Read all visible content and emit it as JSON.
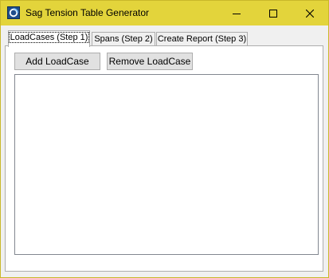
{
  "window": {
    "title": "Sag Tension Table Generator",
    "titlebar_color": "#e3d43b",
    "icons": {
      "app": "app-icon",
      "minimize": "minimize-icon",
      "maximize": "maximize-icon",
      "close": "close-icon"
    }
  },
  "tabs": [
    {
      "label": "LoadCases (Step 1)",
      "selected": true
    },
    {
      "label": "Spans (Step 2)",
      "selected": false
    },
    {
      "label": "Create Report (Step 3)",
      "selected": false
    }
  ],
  "loadcases_page": {
    "add_button_label": "Add LoadCase",
    "remove_button_label": "Remove LoadCase",
    "list_items": []
  }
}
